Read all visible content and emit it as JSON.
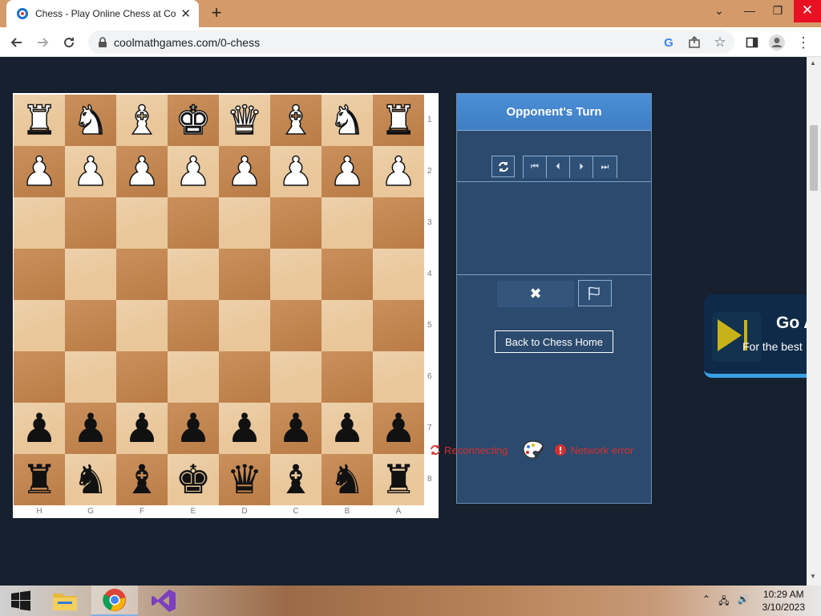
{
  "browser": {
    "tab_title": "Chess - Play Online Chess at Coolmath Games",
    "tab_favicon": "coolmath-favicon-icon",
    "url": "coolmathgames.com/0-chess",
    "accent_color": "#d49a6a"
  },
  "board": {
    "ranks": [
      "1",
      "2",
      "3",
      "4",
      "5",
      "6",
      "7",
      "8"
    ],
    "files": [
      "H",
      "G",
      "F",
      "E",
      "D",
      "C",
      "B",
      "A"
    ],
    "rows": [
      [
        "♜",
        "♞",
        "♝",
        "♚",
        "♛",
        "♝",
        "♞",
        "♜"
      ],
      [
        "♟",
        "♟",
        "♟",
        "♟",
        "♟",
        "♟",
        "♟",
        "♟"
      ],
      [
        "",
        "",
        "",
        "",
        "",
        "",
        "",
        ""
      ],
      [
        "",
        "",
        "",
        "",
        "",
        "",
        "",
        ""
      ],
      [
        "",
        "",
        "",
        "",
        "",
        "",
        "",
        ""
      ],
      [
        "",
        "",
        "",
        "",
        "",
        "",
        "",
        ""
      ],
      [
        "♟",
        "♟",
        "♟",
        "♟",
        "♟",
        "♟",
        "♟",
        "♟"
      ],
      [
        "♜",
        "♞",
        "♝",
        "♚",
        "♛",
        "♝",
        "♞",
        "♜"
      ]
    ],
    "colors": [
      "white",
      "white",
      "",
      "",
      "",
      "",
      "black",
      "black"
    ]
  },
  "panel": {
    "turn_label": "Opponent's Turn",
    "back_button": "Back to Chess Home",
    "header_color": "#4c8fd6"
  },
  "status": {
    "reconnecting": "Reconnecting",
    "network_error": "Network error",
    "error_color": "#d23030"
  },
  "ad": {
    "headline": "Go A",
    "subline": "For the best"
  },
  "taskbar": {
    "time": "10:29 AM",
    "date": "3/10/2023"
  }
}
